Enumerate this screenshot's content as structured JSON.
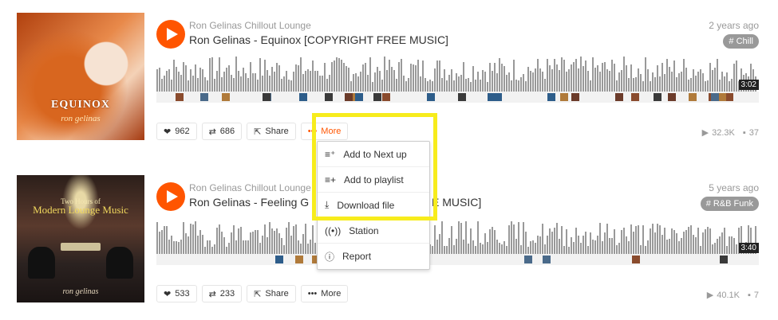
{
  "tracks": [
    {
      "uploader": "Ron Gelinas Chillout Lounge",
      "title": "Ron Gelinas - Equinox [COPYRIGHT FREE MUSIC]",
      "age": "2 years ago",
      "tag": "# Chill",
      "duration": "3:02",
      "artwork": {
        "title": "EQUINOX",
        "subtitle": "ron gelinas"
      },
      "likes": "962",
      "reposts": "686",
      "share_label": "Share",
      "more_label": "More",
      "plays": "32.3K",
      "comments": "37"
    },
    {
      "uploader": "Ron Gelinas Chillout Lounge",
      "title": "Ron Gelinas - Feeling G",
      "title_tail": "E MUSIC]",
      "age": "5 years ago",
      "tag": "# R&B Funk",
      "duration": "3:40",
      "artwork": {
        "pretitle": "Two Hours of",
        "title": "Modern Lounge Music",
        "subtitle": "ron gelinas"
      },
      "likes": "533",
      "reposts": "233",
      "share_label": "Share",
      "more_label": "More",
      "plays": "40.1K",
      "comments": "7"
    }
  ],
  "more_menu": {
    "items": [
      {
        "label": "Add to Next up",
        "icon": "next-up-icon"
      },
      {
        "label": "Add to playlist",
        "icon": "add-to-playlist-icon"
      },
      {
        "label": "Download file",
        "icon": "download-icon"
      },
      {
        "label": "Station",
        "icon": "station-icon"
      },
      {
        "label": "Report",
        "icon": "report-icon"
      }
    ]
  },
  "colors": {
    "accent": "#ff5500",
    "highlight": "#f7ec1c",
    "waveform": "#999999"
  }
}
